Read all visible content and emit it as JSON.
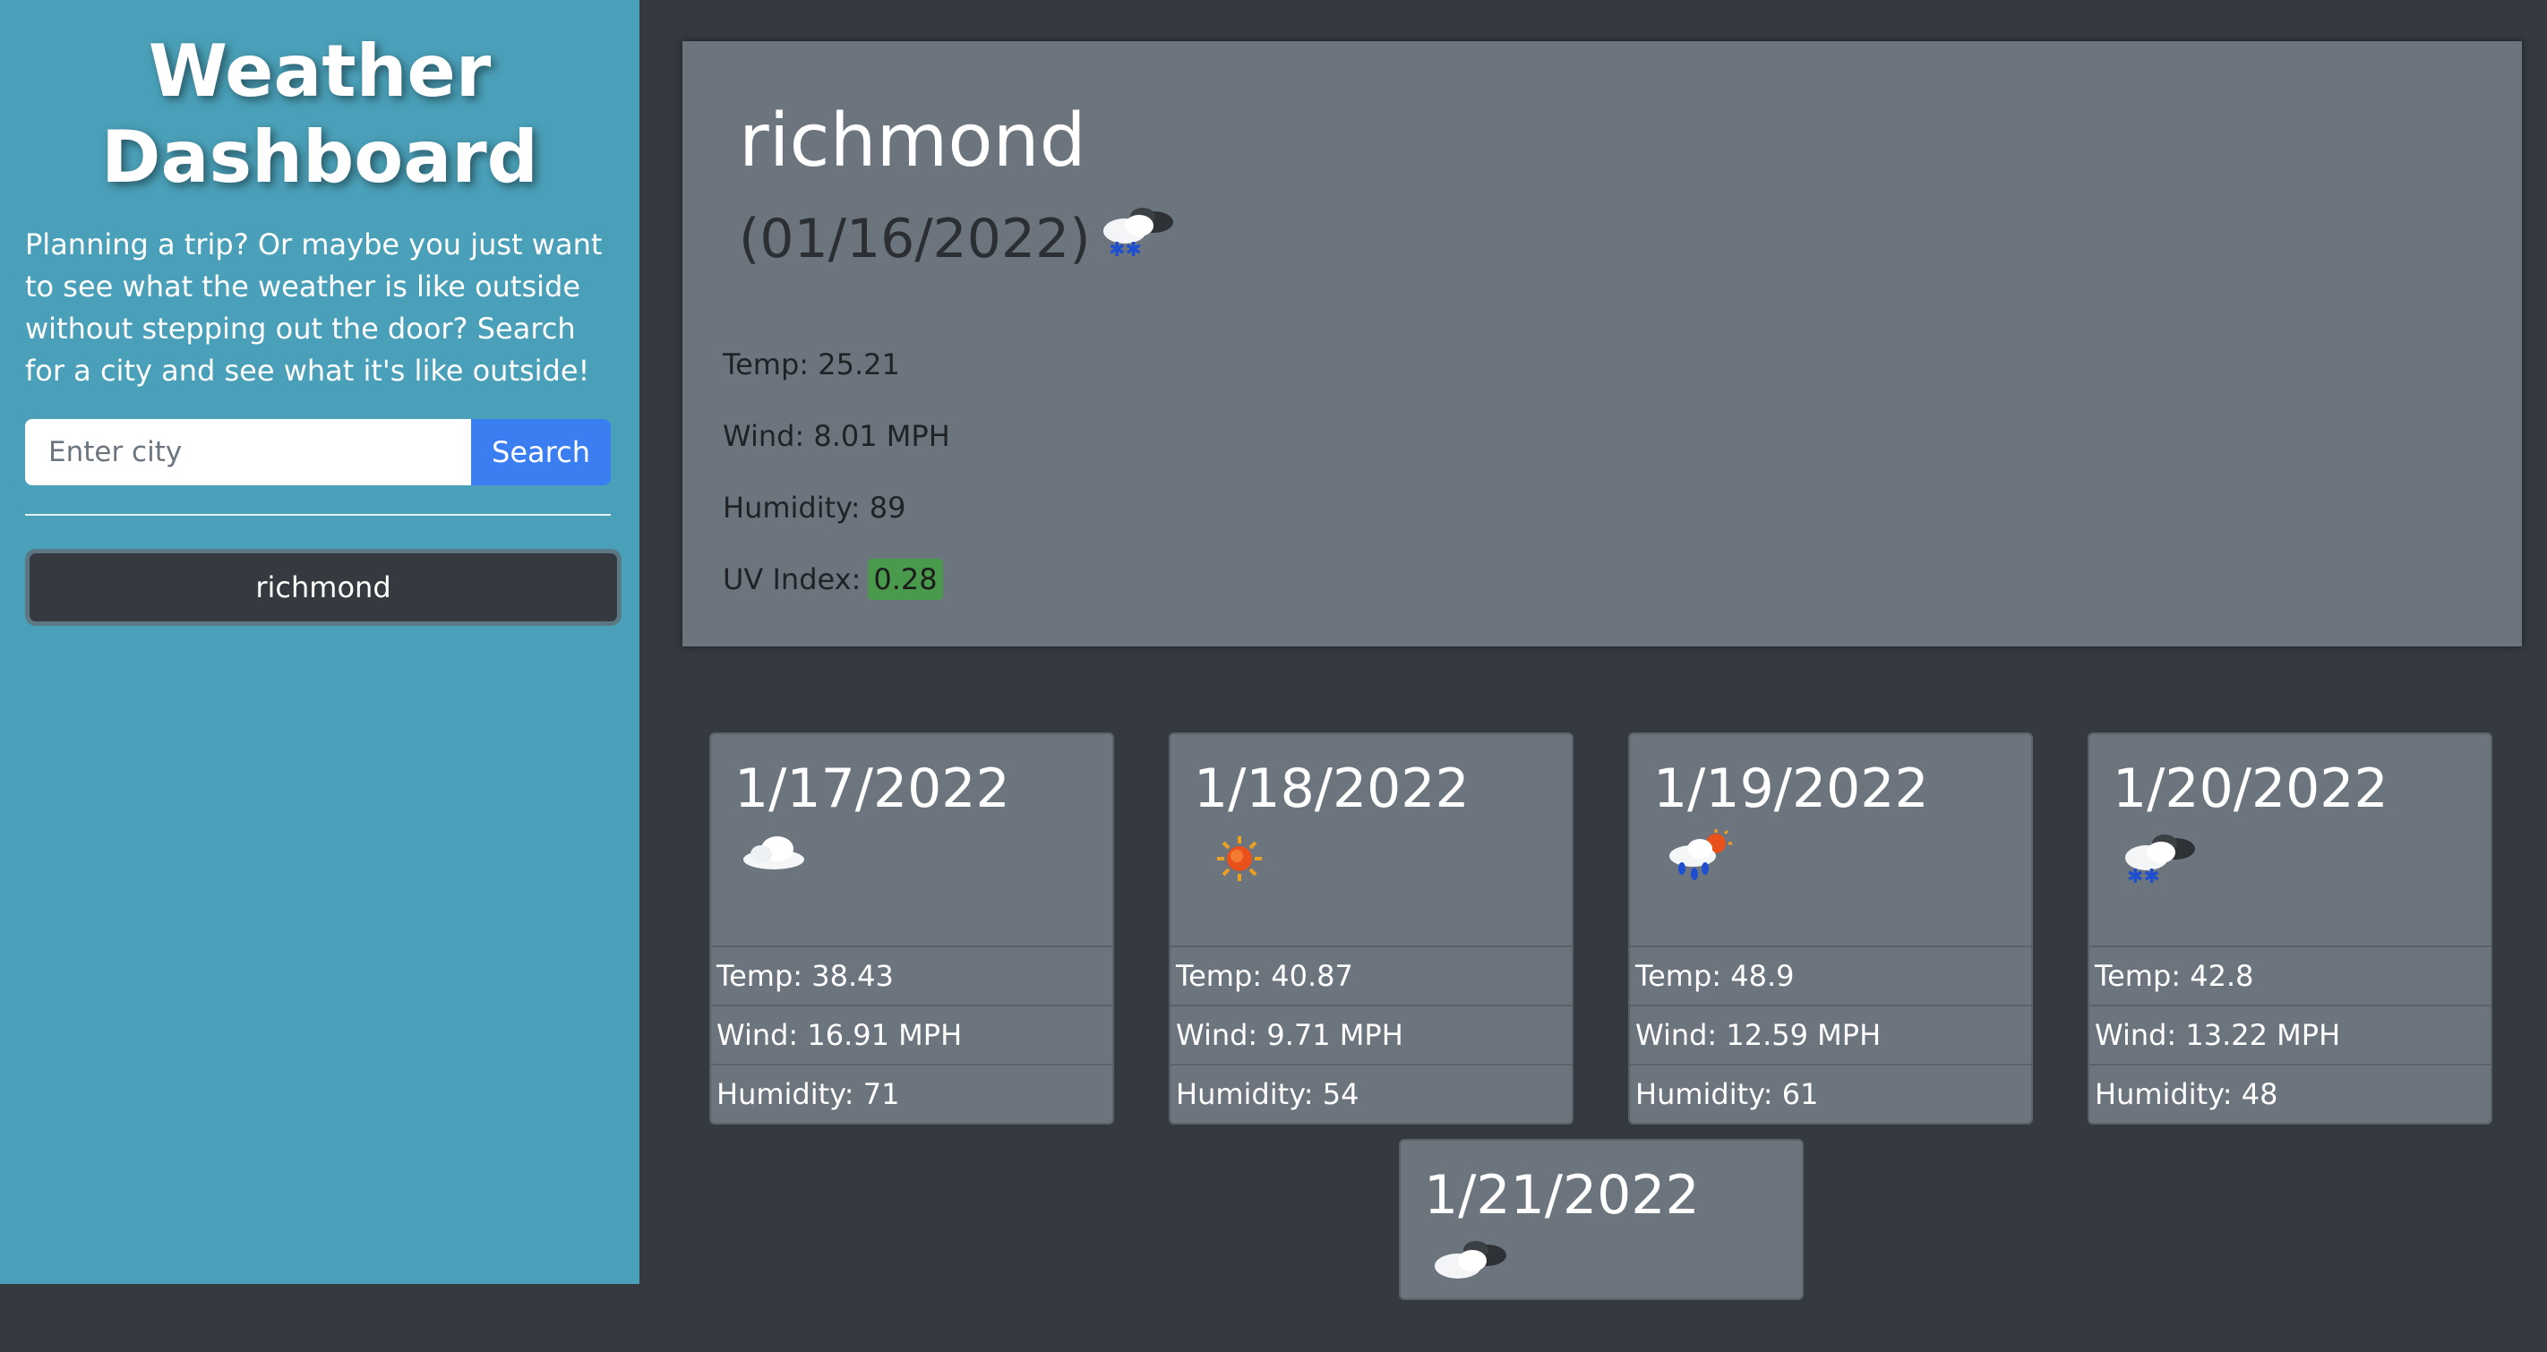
{
  "sidebar": {
    "title": "Weather Dashboard",
    "intro": "Planning a trip? Or maybe you just want to see what the weather is like outside without stepping out the door? Search for a city and see what it's like outside!",
    "search_placeholder": "Enter city",
    "search_label": "Search",
    "history": [
      "richmond"
    ]
  },
  "current": {
    "city": "richmond",
    "date": "(01/16/2022)",
    "icon": "snow-cloud-icon",
    "temp": "Temp: 25.21",
    "wind": "Wind: 8.01 MPH",
    "humidity": "Humidity: 89",
    "uv_label": "UV Index:",
    "uv_value": "0.28",
    "uv_color": "#4a9a4e"
  },
  "forecast": [
    {
      "date": "1/17/2022",
      "icon": "cloud-icon",
      "temp": "Temp: 38.43",
      "wind": "Wind: 16.91 MPH",
      "humidity": "Humidity: 71"
    },
    {
      "date": "1/18/2022",
      "icon": "sun-icon",
      "temp": "Temp: 40.87",
      "wind": "Wind: 9.71 MPH",
      "humidity": "Humidity: 54"
    },
    {
      "date": "1/19/2022",
      "icon": "rain-sun-icon",
      "temp": "Temp: 48.9",
      "wind": "Wind: 12.59 MPH",
      "humidity": "Humidity: 61"
    },
    {
      "date": "1/20/2022",
      "icon": "snow-cloud-icon",
      "temp": "Temp: 42.8",
      "wind": "Wind: 13.22 MPH",
      "humidity": "Humidity: 48"
    },
    {
      "date": "1/21/2022",
      "icon": "cloud-dark-icon",
      "temp": "",
      "wind": "",
      "humidity": ""
    }
  ]
}
